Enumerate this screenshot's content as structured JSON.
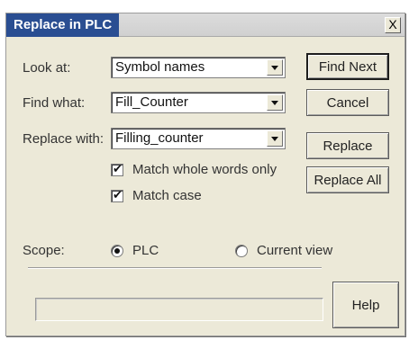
{
  "window": {
    "title": "Replace in PLC",
    "close_label": "X"
  },
  "fields": {
    "look_at": {
      "label": "Look at:",
      "value": "Symbol names"
    },
    "find_what": {
      "label": "Find what:",
      "value": "Fill_Counter"
    },
    "replace_with": {
      "label": "Replace with:",
      "value": "Filling_counter"
    }
  },
  "options": {
    "match_whole_words": {
      "label": "Match whole words only",
      "checked": true
    },
    "match_case": {
      "label": "Match case",
      "checked": true
    }
  },
  "scope": {
    "label": "Scope:",
    "options": [
      {
        "label": "PLC",
        "selected": true
      },
      {
        "label": "Current view",
        "selected": false
      }
    ]
  },
  "buttons": {
    "find_next": "Find Next",
    "cancel": "Cancel",
    "replace": "Replace",
    "replace_all": "Replace All",
    "help": "Help"
  },
  "colors": {
    "title_bar": "#2a4e92",
    "dialog_bg": "#ece9d8"
  }
}
